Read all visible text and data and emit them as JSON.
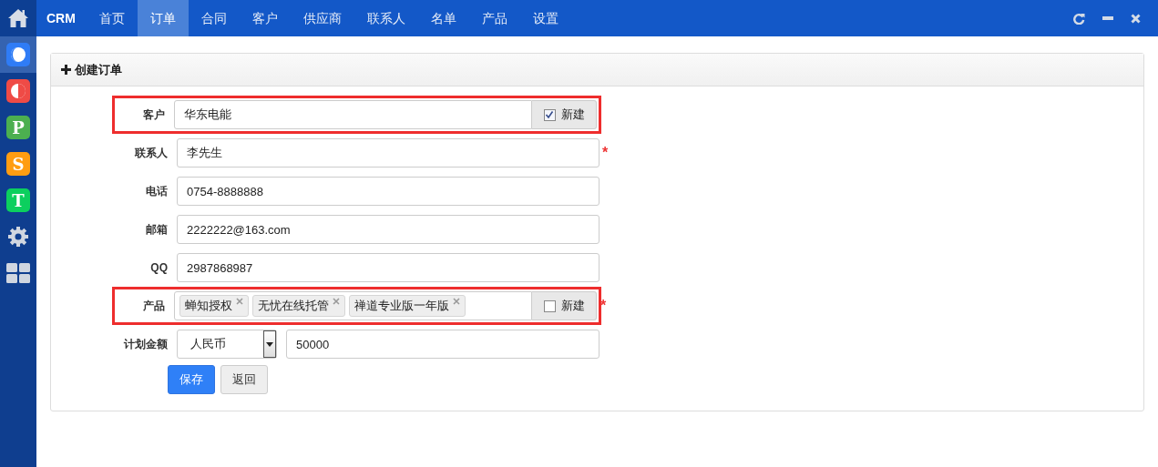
{
  "brand": "CRM",
  "nav": [
    {
      "label": "首页",
      "selected": false
    },
    {
      "label": "订单",
      "selected": true
    },
    {
      "label": "合同",
      "selected": false
    },
    {
      "label": "客户",
      "selected": false
    },
    {
      "label": "供应商",
      "selected": false
    },
    {
      "label": "联系人",
      "selected": false
    },
    {
      "label": "名单",
      "selected": false
    },
    {
      "label": "产品",
      "selected": false
    },
    {
      "label": "设置",
      "selected": false
    }
  ],
  "sidebar": [
    {
      "kind": "moon",
      "selected": true,
      "color": "#2f7cf6"
    },
    {
      "kind": "half",
      "selected": false,
      "color": "#ef4b46"
    },
    {
      "kind": "letter",
      "letter": "P",
      "selected": false,
      "color": "#4caf50"
    },
    {
      "kind": "letter",
      "letter": "S",
      "selected": false,
      "color": "#ff9d12"
    },
    {
      "kind": "letter",
      "letter": "T",
      "selected": false,
      "color": "#0ccf5e"
    },
    {
      "kind": "gear",
      "selected": false
    },
    {
      "kind": "grid",
      "selected": false
    }
  ],
  "panel": {
    "title": "创建订单"
  },
  "form": [
    {
      "kind": "text",
      "label": "客户",
      "value": "华东电能",
      "highlighted": true,
      "addon": {
        "label": "新建",
        "checked": true
      }
    },
    {
      "kind": "text",
      "label": "联系人",
      "value": "李先生",
      "highlighted": false,
      "required_mark": "*"
    },
    {
      "kind": "text",
      "label": "电话",
      "value": "0754-8888888",
      "highlighted": false
    },
    {
      "kind": "text",
      "label": "邮箱",
      "value": "2222222@163.com",
      "highlighted": false
    },
    {
      "kind": "text",
      "label": "QQ",
      "value": "2987868987",
      "highlighted": false
    },
    {
      "kind": "tags",
      "label": "产品",
      "tags": [
        "蝉知授权",
        "无忧在线托管",
        "禅道专业版一年版"
      ],
      "highlighted": true,
      "required_mark": "*",
      "addon": {
        "label": "新建",
        "checked": false
      }
    },
    {
      "kind": "money",
      "label": "计划金额",
      "currency": "人民币",
      "value": "50000",
      "highlighted": false
    }
  ],
  "buttons": [
    {
      "label": "保存",
      "primary": true
    },
    {
      "label": "返回",
      "primary": false
    }
  ]
}
